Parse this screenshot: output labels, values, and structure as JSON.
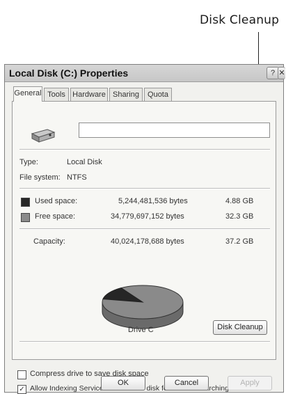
{
  "callout": {
    "label": "Disk Cleanup"
  },
  "window": {
    "title": "Local Disk (C:) Properties",
    "help_glyph": "?",
    "close_glyph": "✕"
  },
  "tabs": [
    {
      "label": "General"
    },
    {
      "label": "Tools"
    },
    {
      "label": "Hardware"
    },
    {
      "label": "Sharing"
    },
    {
      "label": "Quota"
    }
  ],
  "general": {
    "name_value": "",
    "type_label": "Type:",
    "type_value": "Local Disk",
    "fs_label": "File system:",
    "fs_value": "NTFS",
    "used": {
      "label": "Used space:",
      "bytes": "5,244,481,536 bytes",
      "size": "4.88 GB",
      "color": "#262626"
    },
    "free": {
      "label": "Free space:",
      "bytes": "34,779,697,152 bytes",
      "size": "32.3 GB",
      "color": "#8a8a8a"
    },
    "capacity": {
      "label": "Capacity:",
      "bytes": "40,024,178,688 bytes",
      "size": "37.2 GB"
    },
    "used_fraction": 0.131,
    "drive_label": "Drive C",
    "cleanup_button": "Disk Cleanup",
    "compress_label": "Compress drive to save disk space",
    "compress_checked": false,
    "indexing_label": "Allow Indexing Service to index this disk for fast file searching",
    "indexing_checked": true
  },
  "footer": {
    "ok": "OK",
    "cancel": "Cancel",
    "apply": "Apply"
  }
}
